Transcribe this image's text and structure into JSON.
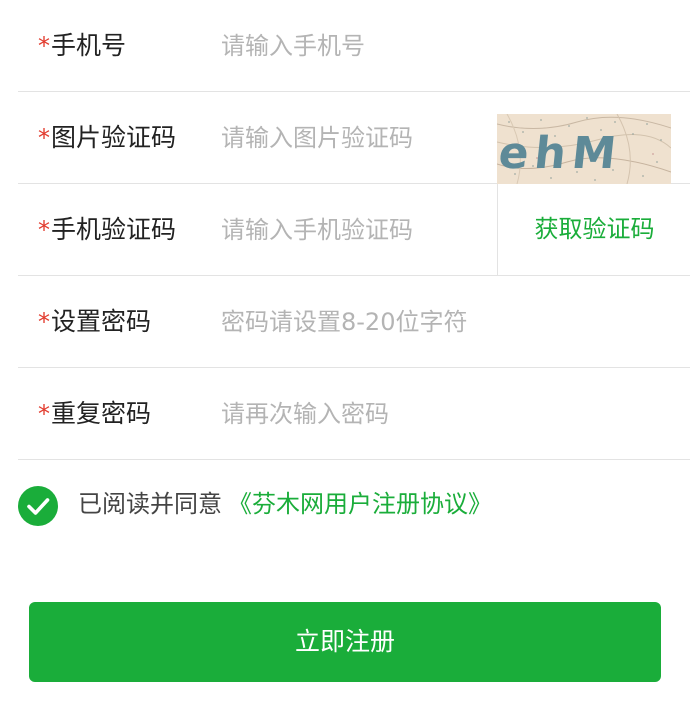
{
  "form": {
    "phone": {
      "required_mark": "*",
      "label": "手机号",
      "placeholder": "请输入手机号",
      "value": ""
    },
    "image_code": {
      "required_mark": "*",
      "label": "图片验证码",
      "placeholder": "请输入图片验证码",
      "value": "",
      "captcha_text": "ehM"
    },
    "sms_code": {
      "required_mark": "*",
      "label": "手机验证码",
      "placeholder": "请输入手机验证码",
      "value": "",
      "button_label": "获取验证码"
    },
    "password": {
      "required_mark": "*",
      "label": "设置密码",
      "placeholder": "密码请设置8-20位字符",
      "value": ""
    },
    "confirm_password": {
      "required_mark": "*",
      "label": "重复密码",
      "placeholder": "请再次输入密码",
      "value": ""
    }
  },
  "agreement": {
    "checked": true,
    "text": "已阅读并同意",
    "link_text": "《芬木网用户注册协议》"
  },
  "submit_label": "立即注册",
  "colors": {
    "accent": "#1aad3a",
    "required": "#e23b2e",
    "placeholder": "#b4b4b4",
    "divider": "#e3e3e3"
  },
  "icons": {
    "checkbox": "check-circle-icon"
  }
}
